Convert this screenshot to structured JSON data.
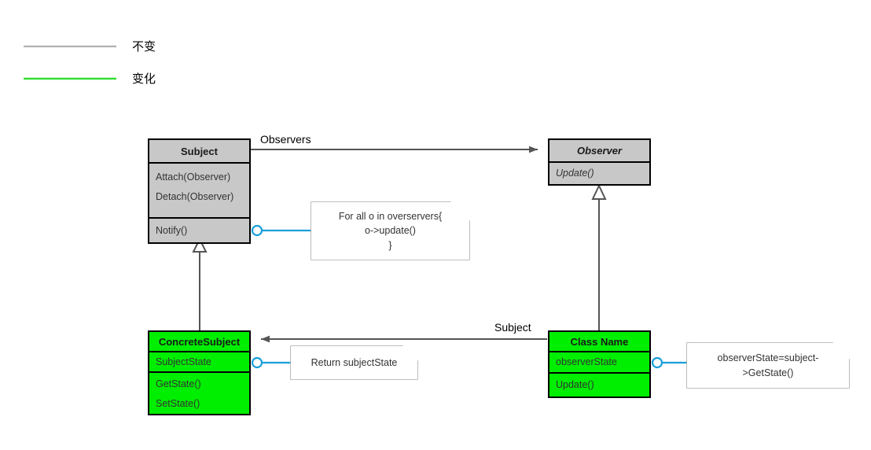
{
  "legend": {
    "items": [
      {
        "label": "不变",
        "color": "#b0b0b0"
      },
      {
        "label": "变化",
        "color": "#33dd33"
      }
    ]
  },
  "classes": {
    "subject": {
      "name": "Subject",
      "title": "Subject",
      "fill": "#c8c8c8",
      "members": [
        "Attach(Observer)",
        "Detach(Observer)"
      ],
      "operations": [
        "Notify()"
      ]
    },
    "observer": {
      "name": "Observer",
      "title": "Observer",
      "fill": "#c8c8c8",
      "members": [
        "Update()"
      ]
    },
    "concrete_subject": {
      "name": "ConcreteSubject",
      "title": "ConcreteSubject",
      "fill": "#00ee00",
      "attributes": [
        "SubjectState"
      ],
      "operations": [
        "GetState()",
        "SetState()"
      ]
    },
    "concrete_observer": {
      "name": "Class Name",
      "title": "Class Name",
      "fill": "#00ee00",
      "attributes": [
        "observerState"
      ],
      "operations": [
        "Update()"
      ]
    }
  },
  "notes": {
    "notify_note": "For all o in overservers{\no->update()\n}",
    "getstate_note": "Return subjectState",
    "update_note": "observerState=subject-\n>GetState()"
  },
  "edges": {
    "observers_label": "Observers",
    "subject_label": "Subject"
  },
  "colors": {
    "connector_blue": "#1a9ed9",
    "line_gray": "#555555",
    "box_gray": "#c8c8c8",
    "box_green": "#00ee00",
    "note_border": "#aaaaaa"
  }
}
